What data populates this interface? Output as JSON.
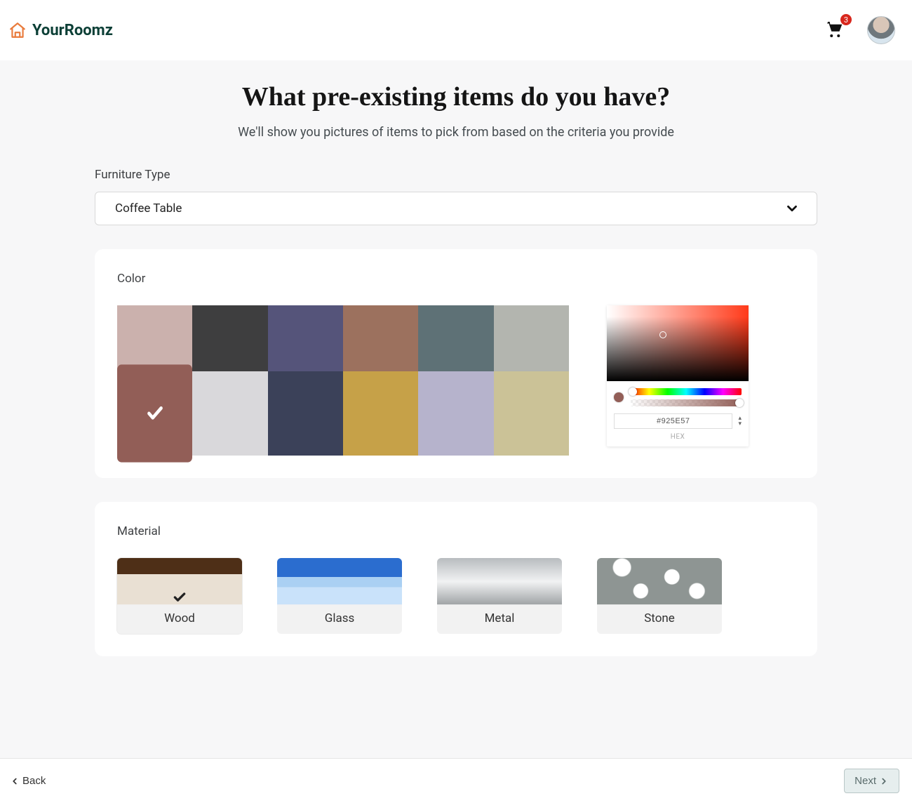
{
  "brand": "YourRoomz",
  "cart_count": "3",
  "page_title": "What pre-existing items do you have?",
  "page_sub": "We'll show you pictures of items to pick from based on the criteria you provide",
  "furniture_type_label": "Furniture Type",
  "furniture_type_selected": "Coffee Table",
  "color_label": "Color",
  "color_swatches": [
    "#cbb1ad",
    "#3e3e3f",
    "#55547a",
    "#9c715e",
    "#5e7176",
    "#b3b5af",
    "#925E57",
    "#d9d8db",
    "#3b4159",
    "#c6a148",
    "#b6b3cc",
    "#cbc297"
  ],
  "selected_swatch_index": 6,
  "picker": {
    "hex_value": "#925E57",
    "hex_label": "HEX"
  },
  "material_label": "Material",
  "materials": [
    {
      "id": "wood",
      "label": "Wood",
      "selected": true
    },
    {
      "id": "glass",
      "label": "Glass",
      "selected": false
    },
    {
      "id": "metal",
      "label": "Metal",
      "selected": false
    },
    {
      "id": "stone",
      "label": "Stone",
      "selected": false
    }
  ],
  "footer": {
    "back": "Back",
    "next": "Next"
  }
}
